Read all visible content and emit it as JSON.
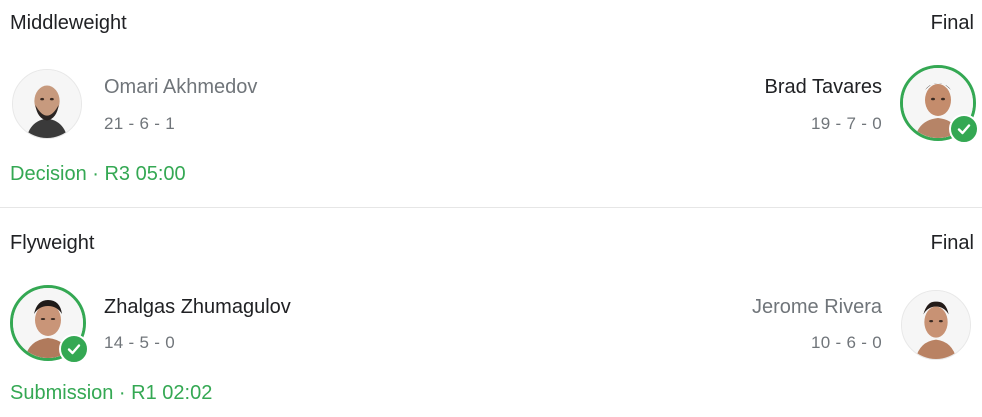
{
  "bouts": [
    {
      "weight_class": "Middleweight",
      "status": "Final",
      "left": {
        "name": "Omari Akhmedov",
        "record": "21 - 6 - 1",
        "winner": false
      },
      "right": {
        "name": "Brad Tavares",
        "record": "19 - 7 - 0",
        "winner": true
      },
      "result": "Decision · R3 05:00"
    },
    {
      "weight_class": "Flyweight",
      "status": "Final",
      "left": {
        "name": "Zhalgas Zhumagulov",
        "record": "14 - 5 - 0",
        "winner": true
      },
      "right": {
        "name": "Jerome Rivera",
        "record": "10 - 6 - 0",
        "winner": false
      },
      "result": "Submission · R1 02:02"
    }
  ],
  "colors": {
    "win_green": "#34a853",
    "muted_gray": "#70757a",
    "text": "#202124"
  },
  "icons": {
    "winner_badge": "check-circle-icon"
  }
}
